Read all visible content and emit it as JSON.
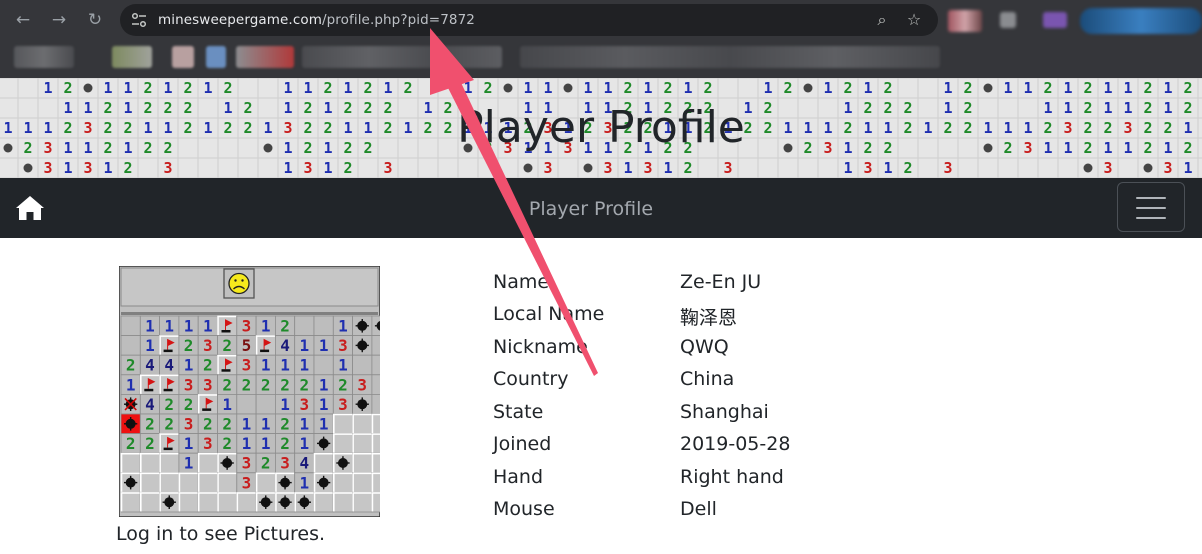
{
  "browser": {
    "url_host": "minesweepergame.com",
    "url_path": "/profile.php?pid=7872"
  },
  "site": {
    "banner_title": "Player Profile",
    "navbar_title": "Player Profile"
  },
  "profile": {
    "login_note": "Log in to see Pictures.",
    "fields": [
      {
        "label": "Name",
        "value": "Ze-En JU"
      },
      {
        "label": "Local Name",
        "value": "鞠泽恩"
      },
      {
        "label": "Nickname",
        "value": "QWQ"
      },
      {
        "label": "Country",
        "value": "China"
      },
      {
        "label": "State",
        "value": "Shanghai"
      },
      {
        "label": "Joined",
        "value": "2019-05-28"
      },
      {
        "label": "Hand",
        "value": "Right hand"
      },
      {
        "label": "Mouse",
        "value": "Dell"
      }
    ]
  },
  "colors": {
    "chrome_bg": "#35363a",
    "omnibox_bg": "#202124",
    "navbar_bg": "#212529",
    "annotation_arrow": "#f0506e"
  },
  "icons": [
    "back-arrow-icon",
    "forward-arrow-icon",
    "reload-icon",
    "site-settings-icon",
    "zoom-icon",
    "bookmark-star-icon",
    "home-icon",
    "hamburger-menu-icon",
    "sad-face-icon"
  ]
}
